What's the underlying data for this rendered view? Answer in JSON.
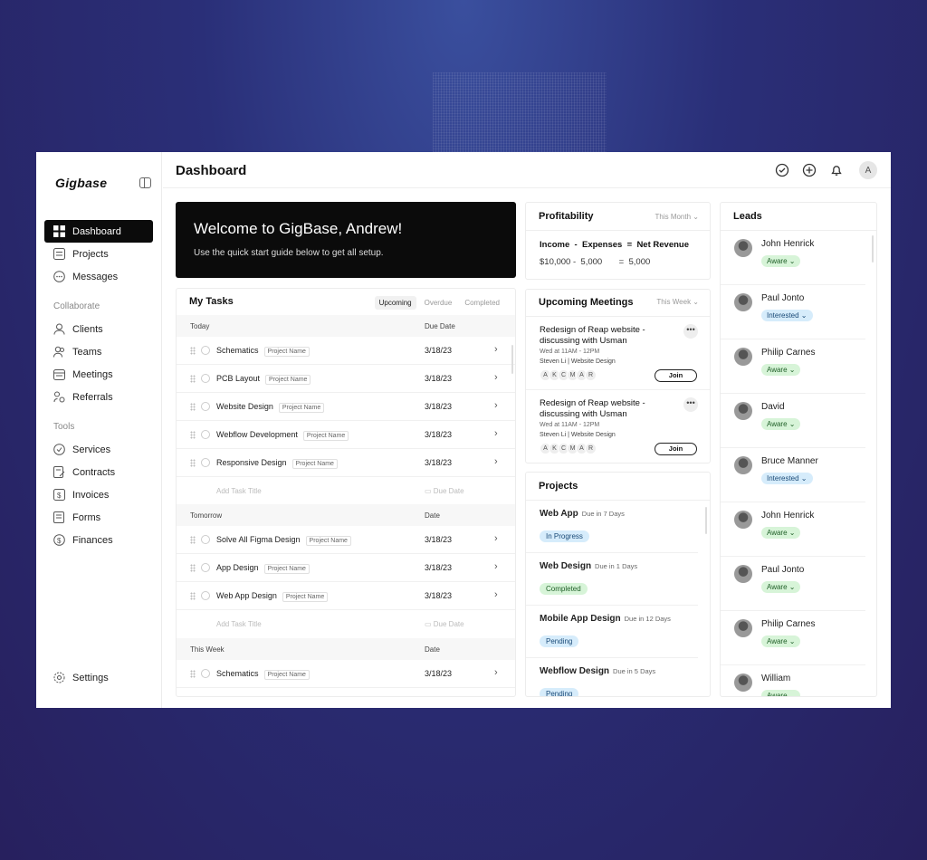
{
  "brand": "Gigbase",
  "nav": {
    "main": [
      {
        "label": "Dashboard",
        "icon": "grid-icon",
        "active": true
      },
      {
        "label": "Projects",
        "icon": "list-icon"
      },
      {
        "label": "Messages",
        "icon": "chat-icon"
      }
    ],
    "collaborate_title": "Collaborate",
    "collaborate": [
      {
        "label": "Clients",
        "icon": "user-icon"
      },
      {
        "label": "Teams",
        "icon": "users-icon"
      },
      {
        "label": "Meetings",
        "icon": "calendar-icon"
      },
      {
        "label": "Referrals",
        "icon": "referral-icon"
      }
    ],
    "tools_title": "Tools",
    "tools": [
      {
        "label": "Services",
        "icon": "service-icon"
      },
      {
        "label": "Contracts",
        "icon": "contract-icon"
      },
      {
        "label": "Invoices",
        "icon": "invoice-icon"
      },
      {
        "label": "Forms",
        "icon": "form-icon"
      },
      {
        "label": "Finances",
        "icon": "dollar-icon"
      }
    ],
    "settings": "Settings"
  },
  "header": {
    "title": "Dashboard",
    "avatar": "A"
  },
  "welcome": {
    "title": "Welcome to GigBase, Andrew!",
    "subtitle": "Use the quick start guide below to get all setup."
  },
  "tasks": {
    "title": "My Tasks",
    "tabs": [
      "Upcoming",
      "Overdue",
      "Completed"
    ],
    "today": {
      "label": "Today",
      "col": "Due Date",
      "rows": [
        {
          "name": "Schematics",
          "project": "Project Name",
          "date": "3/18/23"
        },
        {
          "name": "PCB Layout",
          "project": "Project Name",
          "date": "3/18/23"
        },
        {
          "name": "Website Design",
          "project": "Project Name",
          "date": "3/18/23"
        },
        {
          "name": "Webflow Development",
          "project": "Project Name",
          "date": "3/18/23"
        },
        {
          "name": "Responsive Design",
          "project": "Project Name",
          "date": "3/18/23"
        }
      ]
    },
    "tomorrow": {
      "label": "Tomorrow",
      "col": "Date",
      "rows": [
        {
          "name": "Solve All Figma Design",
          "project": "Project Name",
          "date": "3/18/23"
        },
        {
          "name": "App Design",
          "project": "Project Name",
          "date": "3/18/23"
        },
        {
          "name": "Web App Design",
          "project": "Project Name",
          "date": "3/18/23"
        }
      ]
    },
    "week": {
      "label": "This Week",
      "col": "Date",
      "rows": [
        {
          "name": "Schematics",
          "project": "Project Name",
          "date": "3/18/23"
        }
      ]
    },
    "add_title": "Add Task Title",
    "add_date": "Due Date"
  },
  "profit": {
    "title": "Profitability",
    "range": "This Month",
    "formula": "Income  -  Expenses  =  Net Revenue",
    "values": "$10,000 -  5,000       =  5,000"
  },
  "meetings": {
    "title": "Upcoming Meetings",
    "range": "This Week",
    "items": [
      {
        "title": "Redesign of Reap website - discussing with Usman",
        "when": "Wed at 11AM - 12PM",
        "who": "Steven Li | Website Design",
        "avatars": [
          "A",
          "K",
          "C",
          "M",
          "A",
          "R"
        ],
        "join": "Join"
      },
      {
        "title": "Redesign of Reap website - discussing with Usman",
        "when": "Wed at 11AM - 12PM",
        "who": "Steven Li | Website Design",
        "avatars": [
          "A",
          "K",
          "C",
          "M",
          "A",
          "R"
        ],
        "join": "Join"
      }
    ]
  },
  "projects": {
    "title": "Projects",
    "items": [
      {
        "name": "Web App",
        "due": "Due in 7 Days",
        "status": "In Progress",
        "color": "blue"
      },
      {
        "name": "Web Design",
        "due": "Due in 1 Days",
        "status": "Completed",
        "color": "green"
      },
      {
        "name": "Mobile App Design",
        "due": "Due in 12 Days",
        "status": "Pending",
        "color": "blue"
      },
      {
        "name": "Webflow Design",
        "due": "Due in 5 Days",
        "status": "Pending",
        "color": "blue"
      }
    ]
  },
  "leads": {
    "title": "Leads",
    "items": [
      {
        "name": "John Henrick",
        "status": "Aware",
        "color": "green"
      },
      {
        "name": "Paul Jonto",
        "status": "Interested",
        "color": "blue"
      },
      {
        "name": "Philip Carnes",
        "status": "Aware",
        "color": "green"
      },
      {
        "name": "David",
        "status": "Aware",
        "color": "green"
      },
      {
        "name": "Bruce Manner",
        "status": "Interested",
        "color": "blue"
      },
      {
        "name": "John Henrick",
        "status": "Aware",
        "color": "green"
      },
      {
        "name": "Paul Jonto",
        "status": "Aware",
        "color": "green"
      },
      {
        "name": "Philip Carnes",
        "status": "Aware",
        "color": "green"
      },
      {
        "name": "William",
        "status": "Aware",
        "color": "green"
      }
    ]
  }
}
